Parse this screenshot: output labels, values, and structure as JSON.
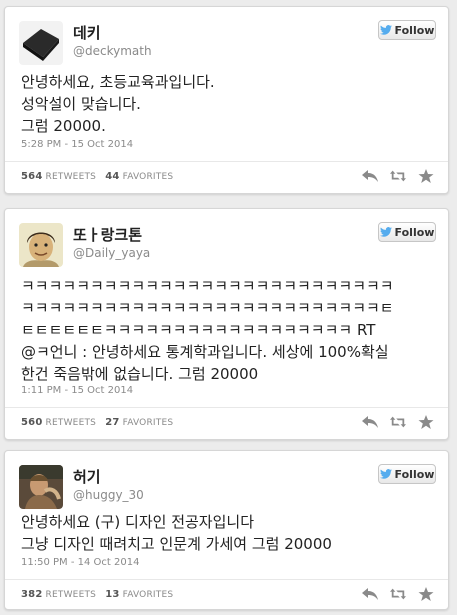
{
  "follow_label": "Follow",
  "tweets": [
    {
      "name": "데키",
      "handle": "@deckymath",
      "text": "안녕하세요, 초등교육과입니다.\n성악설이 맞습니다.\n그럼 20000.",
      "time": "5:28 PM - 15 Oct 2014",
      "retweets": "564",
      "retweets_label": "RETWEETS",
      "favorites": "44",
      "favorites_label": "FAVORITES"
    },
    {
      "name": "또ㅏ랑크톤",
      "handle": "@Daily_yaya",
      "text": "ㅋㅋㅋㅋㅋㅋㅋㅋㅋㅋㅋㅋㅋㅋㅋㅋㅋㅋㅋㅋㅋㅋㅋㅋㅋㅋㅋ\nㅋㅋㅋㅋㅋㅋㅋㅋㅋㅋㅋㅋㅋㅋㅋㅋㅋㅋㅋㅋㅋㅋㅋㅋㅋㅋㅌ\nㅌㅌㅌㅌㅌㅌㅋㅋㅋㅋㅋㅋㅋㅋㅋㅋㅋㅋㅋㅋㅋㅋㅋㅋ RT\n@ㅋ언니 : 안녕하세요 통계학과입니다. 세상에 100%확실\n한건 죽음밖에 없습니다. 그럼 20000",
      "time": "1:11 PM - 15 Oct 2014",
      "retweets": "560",
      "retweets_label": "RETWEETS",
      "favorites": "27",
      "favorites_label": "FAVORITES"
    },
    {
      "name": "허기",
      "handle": "@huggy_30",
      "text": "안녕하세요 (구) 디자인 전공자입니다\n그냥 디자인 때려치고 인문계 가세여 그럼 20000",
      "time": "11:50 PM - 14 Oct 2014",
      "retweets": "382",
      "retweets_label": "RETWEETS",
      "favorites": "13",
      "favorites_label": "FAVORITES"
    }
  ],
  "colors": {
    "twitter_bird": "#55acee",
    "action_icon": "#8a8a8a"
  }
}
